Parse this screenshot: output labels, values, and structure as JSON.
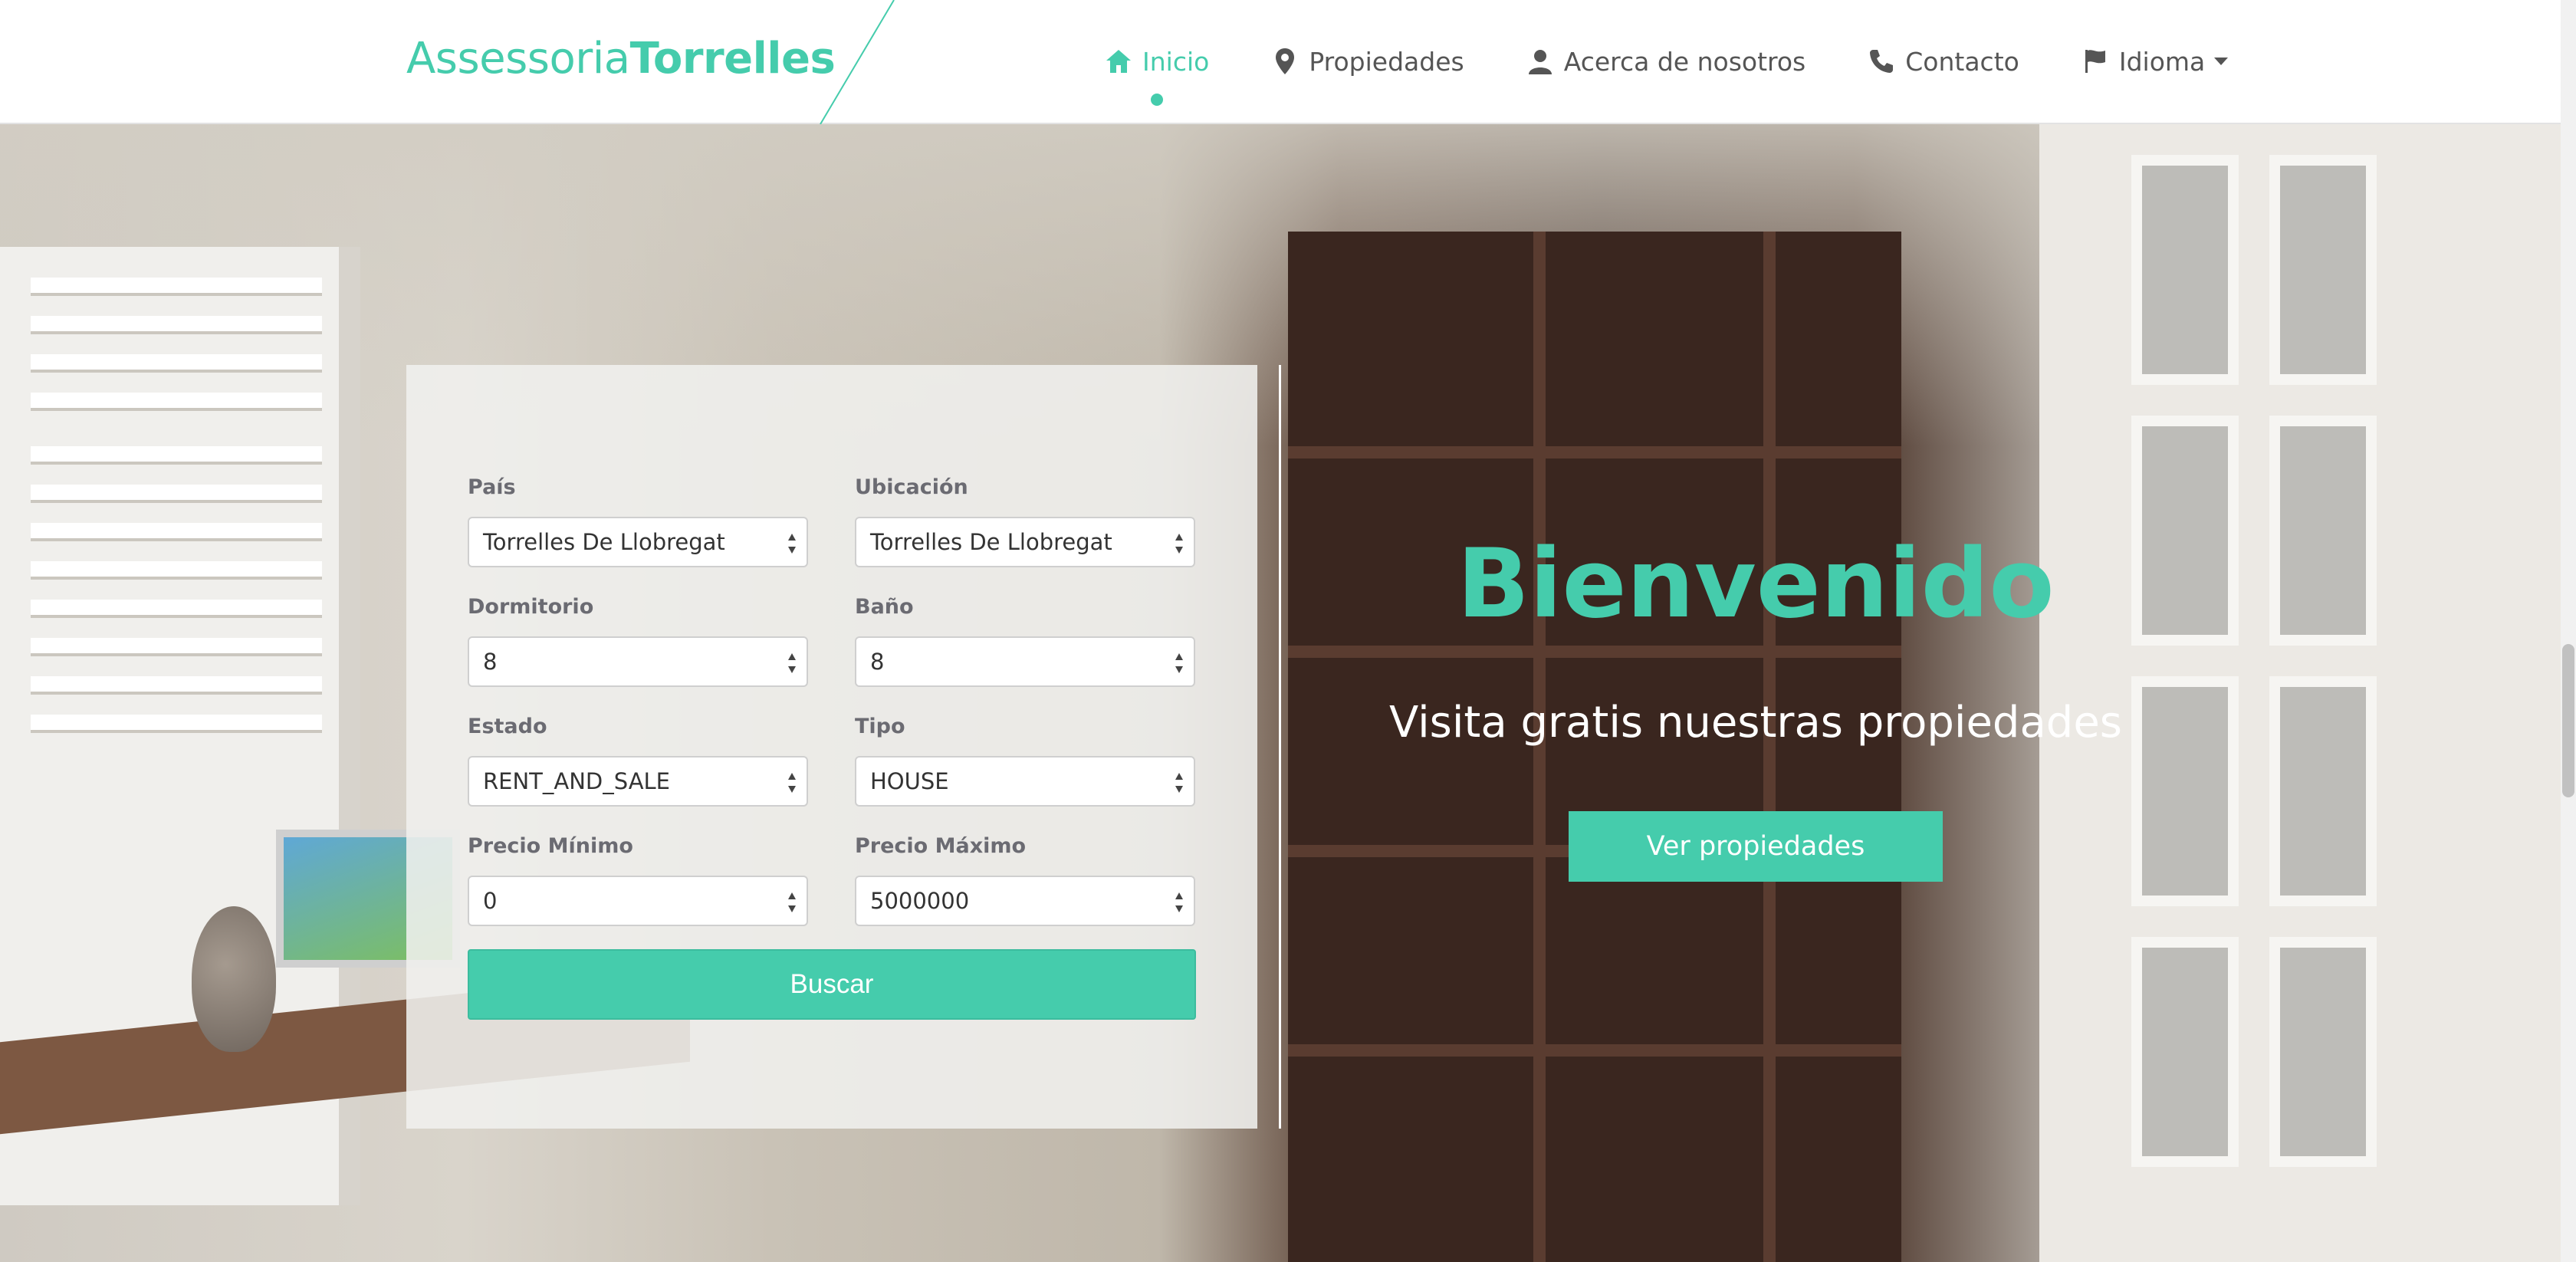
{
  "brand": {
    "name_light": "Assessoria",
    "name_bold": "Torrelles"
  },
  "nav": {
    "items": [
      {
        "label": "Inicio",
        "icon": "home-icon",
        "active": true
      },
      {
        "label": "Propiedades",
        "icon": "map-marker-icon",
        "active": false
      },
      {
        "label": "Acerca de nosotros",
        "icon": "user-icon",
        "active": false
      },
      {
        "label": "Contacto",
        "icon": "phone-icon",
        "active": false
      },
      {
        "label": "Idioma",
        "icon": "flag-icon",
        "active": false,
        "dropdown": true
      }
    ]
  },
  "search": {
    "pais": {
      "label": "País",
      "value": "Torrelles De Llobregat"
    },
    "ubicacion": {
      "label": "Ubicación",
      "value": "Torrelles De Llobregat"
    },
    "dormitorio": {
      "label": "Dormitorio",
      "value": "8"
    },
    "bano": {
      "label": "Baño",
      "value": "8"
    },
    "estado": {
      "label": "Estado",
      "value": "RENT_AND_SALE"
    },
    "tipo": {
      "label": "Tipo",
      "value": "HOUSE"
    },
    "precio_min": {
      "label": "Precio Mínimo",
      "value": "0"
    },
    "precio_max": {
      "label": "Precio Máximo",
      "value": "5000000"
    },
    "submit_label": "Buscar"
  },
  "welcome": {
    "title": "Bienvenido",
    "subtitle": "Visita gratis nuestras propiedades",
    "cta_label": "Ver propiedades"
  },
  "colors": {
    "accent": "#45ccac",
    "nav_text": "#555555",
    "label": "#6b6b72"
  }
}
